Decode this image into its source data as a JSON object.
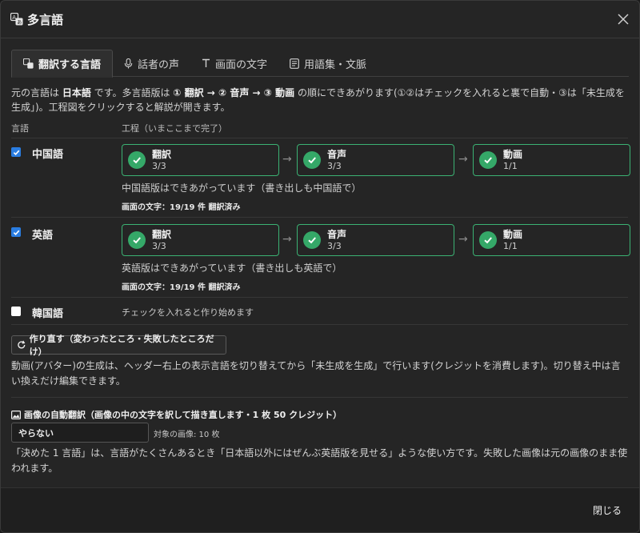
{
  "dialog": {
    "title": "多言語",
    "close_label": "閉じる"
  },
  "tabs": [
    {
      "label": "翻訳する言語",
      "active": true,
      "icon": "translate-icon"
    },
    {
      "label": "話者の声",
      "active": false,
      "icon": "microphone-icon"
    },
    {
      "label": "画面の文字",
      "active": false,
      "icon": "text-icon"
    },
    {
      "label": "用語集・文脈",
      "active": false,
      "icon": "glossary-icon"
    }
  ],
  "intro": {
    "p1": "元の言語は ",
    "lang": "日本語",
    "p2": " です。多言語版は ",
    "s1": "① 翻訳 → ② 音声 → ③ 動画",
    "p3": " の順にできあがります(①②はチェックを入れると裏で自動・③は「未生成を生成」)。工程図をクリックすると解説が開きます。"
  },
  "columns": {
    "language": "言語",
    "process": "工程（いまここまで完了）"
  },
  "languages": [
    {
      "name": "中国語",
      "checked": true,
      "steps": [
        {
          "label": "翻訳",
          "count": "3/3"
        },
        {
          "label": "音声",
          "count": "3/3"
        },
        {
          "label": "動画",
          "count": "1/1"
        }
      ],
      "status": "中国語版はできあがっています（書き出しも中国語で）",
      "screen_text": "画面の文字：19/19 件 翻訳済み"
    },
    {
      "name": "英語",
      "checked": true,
      "steps": [
        {
          "label": "翻訳",
          "count": "3/3"
        },
        {
          "label": "音声",
          "count": "3/3"
        },
        {
          "label": "動画",
          "count": "1/1"
        }
      ],
      "status": "英語版はできあがっています（書き出しも英語で）",
      "screen_text": "画面の文字：19/19 件 翻訳済み"
    },
    {
      "name": "韓国語",
      "checked": false,
      "hint": "チェックを入れると作り始めます"
    }
  ],
  "redo_button": "作り直す（変わったところ・失敗したところだけ）",
  "avatar_note": "動画(アバター)の生成は、ヘッダー右上の表示言語を切り替えてから「未生成を生成」で行います(クレジットを消費します)。切り替え中は言い換えだけ編集できます。",
  "image_translation": {
    "title": "画像の自動翻訳（画像の中の文字を訳して描き直します・1 枚 50 クレジット）",
    "select_value": "やらない",
    "target_count": "対象の画像: 10 枚",
    "note": "「決めた 1 言語」は、言語がたくさんあるとき「日本語以外にはぜんぶ英語版を見せる」ような使い方です。失敗した画像は元の画像のまま使われます。"
  },
  "colors": {
    "accent_blue": "#2a7de1",
    "done_green": "#35a868",
    "step_border": "#3bb273"
  }
}
